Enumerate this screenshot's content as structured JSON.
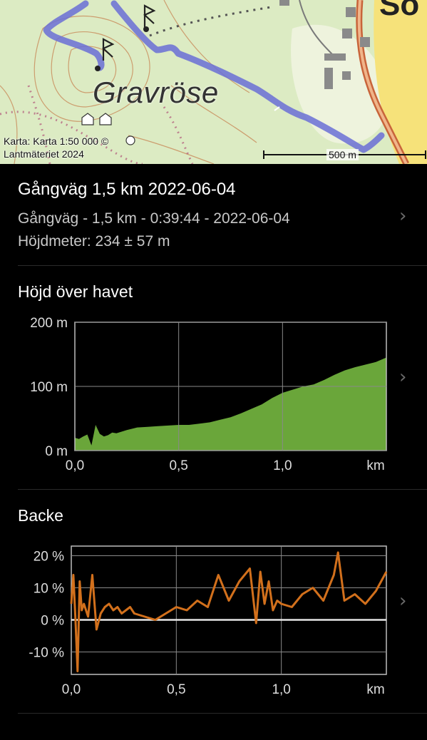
{
  "map": {
    "attribution_line1": "Karta: Karta 1:50 000 ©",
    "attribution_line2": "Lantmäteriet 2024",
    "scale_label": "500 m",
    "place_name": "Gravröse",
    "corner_text": "So",
    "route_color": "#6a6fd6",
    "background_color": "#dcebc3"
  },
  "track": {
    "title": "Gångväg 1,5 km 2022-06-04",
    "summary": "Gångväg - 1,5 km - 0:39:44 - 2022-06-04",
    "elevation_meters": "Höjdmeter: 234 ± 57 m"
  },
  "altitude_section": {
    "title": "Höjd över havet"
  },
  "slope_section": {
    "title": "Backe"
  },
  "chart_data": [
    {
      "type": "area",
      "title": "Höjd över havet",
      "xlabel": "km",
      "ylabel": "",
      "xlim": [
        0,
        1.5
      ],
      "ylim": [
        0,
        200
      ],
      "x_ticks": [
        "0,0",
        "0,5",
        "1,0",
        "km"
      ],
      "y_ticks": [
        "200 m",
        "100 m",
        "0 m"
      ],
      "grid": true,
      "color": "#6aa63a",
      "x": [
        0,
        0.02,
        0.04,
        0.06,
        0.08,
        0.1,
        0.12,
        0.14,
        0.16,
        0.18,
        0.2,
        0.25,
        0.3,
        0.35,
        0.4,
        0.45,
        0.5,
        0.55,
        0.6,
        0.65,
        0.7,
        0.75,
        0.8,
        0.85,
        0.9,
        0.95,
        1.0,
        1.05,
        1.1,
        1.15,
        1.2,
        1.25,
        1.3,
        1.35,
        1.4,
        1.45,
        1.5
      ],
      "y": [
        20,
        18,
        22,
        25,
        8,
        40,
        26,
        22,
        24,
        28,
        27,
        32,
        36,
        37,
        38,
        39,
        40,
        40,
        42,
        44,
        48,
        52,
        58,
        65,
        72,
        82,
        90,
        95,
        100,
        103,
        110,
        118,
        125,
        130,
        134,
        138,
        145
      ]
    },
    {
      "type": "line",
      "title": "Backe",
      "xlabel": "km",
      "ylabel": "",
      "xlim": [
        0,
        1.5
      ],
      "ylim": [
        -17,
        23
      ],
      "x_ticks": [
        "0,0",
        "0,5",
        "1,0",
        "km"
      ],
      "y_ticks": [
        "20 %",
        "10 %",
        "0 %",
        "-10 %"
      ],
      "grid": true,
      "color": "#d2701c",
      "x": [
        0,
        0.01,
        0.02,
        0.03,
        0.04,
        0.05,
        0.06,
        0.08,
        0.1,
        0.12,
        0.14,
        0.16,
        0.18,
        0.2,
        0.22,
        0.24,
        0.26,
        0.28,
        0.3,
        0.35,
        0.4,
        0.45,
        0.5,
        0.55,
        0.6,
        0.65,
        0.7,
        0.75,
        0.8,
        0.85,
        0.88,
        0.9,
        0.92,
        0.94,
        0.96,
        0.98,
        1.0,
        1.05,
        1.1,
        1.15,
        1.2,
        1.25,
        1.27,
        1.3,
        1.35,
        1.4,
        1.45,
        1.5
      ],
      "y": [
        5,
        14,
        0,
        -16,
        12,
        3,
        5,
        1,
        14,
        -3,
        2,
        4,
        5,
        3,
        4,
        2,
        3,
        4,
        2,
        1,
        0,
        2,
        4,
        3,
        6,
        4,
        14,
        6,
        12,
        16,
        -1,
        15,
        5,
        12,
        3,
        6,
        5,
        4,
        8,
        10,
        6,
        14,
        21,
        6,
        8,
        5,
        9,
        15
      ]
    }
  ]
}
